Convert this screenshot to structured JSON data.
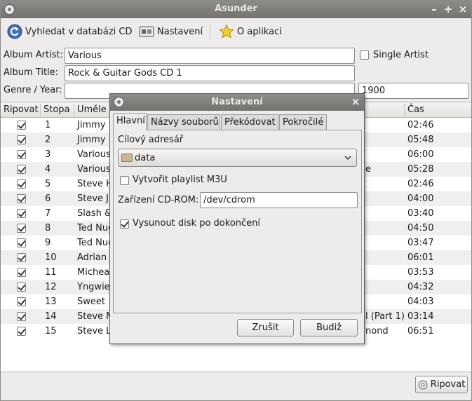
{
  "window": {
    "title": "Asunder"
  },
  "toolbar": {
    "lookup_label": "Vyhledat v databázi CD",
    "preferences_label": "Nastavení",
    "about_label": "O aplikaci"
  },
  "form": {
    "album_artist_label": "Album Artist:",
    "album_artist_value": "Various",
    "single_artist_label": "Single Artist",
    "single_artist_checked": false,
    "album_title_label": "Album Title:",
    "album_title_value": "Rock & Guitar Gods CD 1",
    "genre_year_label": "Genre / Year:",
    "genre_value": "",
    "year_value": "1900"
  },
  "tracklist": {
    "columns": {
      "rip": "Ripovat",
      "track": "Stopa",
      "artist": "Uměle",
      "time": "Čas"
    },
    "rows": [
      {
        "num": "1",
        "artist": "Jimmy",
        "title": "",
        "time": "02:46"
      },
      {
        "num": "2",
        "artist": "Jimmy",
        "title": "",
        "time": "05:48"
      },
      {
        "num": "3",
        "artist": "Various",
        "title": "",
        "time": "06:00"
      },
      {
        "num": "4",
        "artist": "Various",
        "title": "e",
        "time": "05:28"
      },
      {
        "num": "5",
        "artist": "Steve H",
        "title": "",
        "time": "02:46"
      },
      {
        "num": "6",
        "artist": "Steve J",
        "title": "",
        "time": "04:00"
      },
      {
        "num": "7",
        "artist": "Slash &",
        "title": "",
        "time": "03:40"
      },
      {
        "num": "8",
        "artist": "Ted Nug",
        "title": "",
        "time": "04:50"
      },
      {
        "num": "9",
        "artist": "Ted Nug",
        "title": "",
        "time": "03:47"
      },
      {
        "num": "10",
        "artist": "Adrian",
        "title": "",
        "time": "06:01"
      },
      {
        "num": "11",
        "artist": "Michea",
        "title": "",
        "time": "03:53"
      },
      {
        "num": "12",
        "artist": "Yngwie",
        "title": "",
        "time": "04:32"
      },
      {
        "num": "13",
        "artist": "Sweet",
        "title": "",
        "time": "04:03"
      },
      {
        "num": "14",
        "artist": "Steve M",
        "title": "l (Part 1)",
        "time": "03:14"
      },
      {
        "num": "15",
        "artist": "Steve L",
        "title": "nond",
        "time": "06:51"
      }
    ]
  },
  "rip_button": "Ripovat",
  "dialog": {
    "title": "Nastavení",
    "tabs": [
      "Hlavní",
      "Názvy souborů",
      "Překódovat",
      "Pokročilé"
    ],
    "dest_label": "Cílový adresář",
    "dest_value": "data",
    "playlist_label": "Vytvořit playlist M3U",
    "playlist_checked": false,
    "cdrom_label": "Zařízení CD-ROM:",
    "cdrom_value": "/dev/cdrom",
    "eject_label": "Vysunout disk po dokončení",
    "eject_checked": true,
    "cancel_label": "Zrušit",
    "ok_label": "Budiž"
  }
}
